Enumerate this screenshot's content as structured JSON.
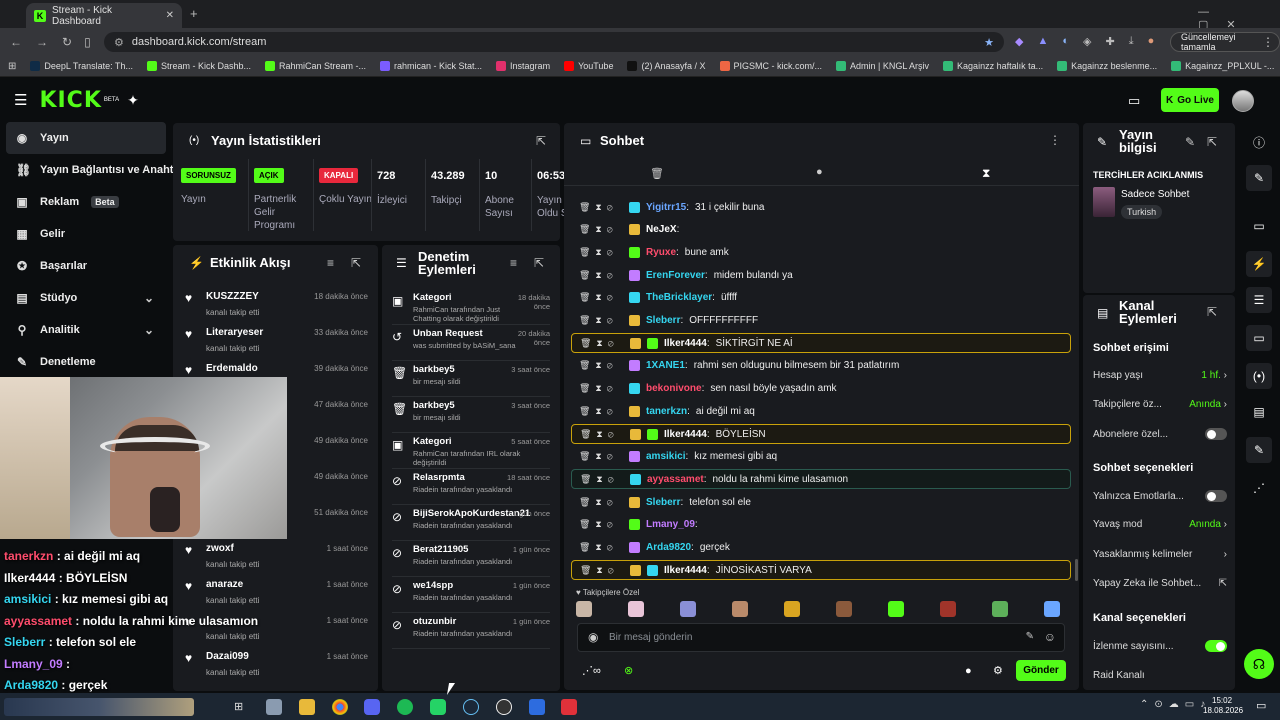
{
  "browser": {
    "tab_title": "Stream - Kick Dashboard",
    "url": "dashboard.kick.com/stream",
    "update_label": "Güncellemeyi tamamla",
    "bookmarks": [
      "DeepL Translate: Th...",
      "Stream - Kick Dashb...",
      "RahmiCan Stream -...",
      "rahmican - Kick Stat...",
      "Instagram",
      "YouTube",
      "(2) Anasayfa / X",
      "PIGSMC - kick.com/...",
      "Admin | KNGL Arşiv",
      "Kagainzz haftalık ta...",
      "Kagainzz beslenme...",
      "Kagainzz_PPLXUL -..."
    ]
  },
  "header": {
    "logo": "KICK",
    "logo_sup": "BETA",
    "go_live": "Go Live"
  },
  "sidebar": {
    "items": [
      {
        "label": "Yayın",
        "icon": "broadcast-icon"
      },
      {
        "label": "Yayın Bağlantısı ve Anahtar",
        "icon": "link-icon"
      },
      {
        "label": "Reklam",
        "icon": "ad-icon",
        "badge": "Beta"
      },
      {
        "label": "Gelir",
        "icon": "money-icon"
      },
      {
        "label": "Başarılar",
        "icon": "trophy-icon"
      },
      {
        "label": "Stüdyo",
        "icon": "studio-icon"
      },
      {
        "label": "Analitik",
        "icon": "chart-icon"
      },
      {
        "label": "Denetleme",
        "icon": "hammer-icon"
      }
    ]
  },
  "stats": {
    "title": "Yayın İstatistikleri",
    "cols": [
      {
        "tag": "SORUNSUZ",
        "label": "Yayın",
        "tag_color": "#53fc18"
      },
      {
        "tag": "AÇIK",
        "label": "Partnerlik Gelir Programı",
        "tag_color": "#53fc18"
      },
      {
        "tag": "KAPALI",
        "label": "Çoklu Yayın",
        "tag_color": "#e8283c"
      },
      {
        "value": "728",
        "label": "İzleyici"
      },
      {
        "value": "43.289",
        "label": "Takipçi"
      },
      {
        "value": "10",
        "label": "Abone Sayısı"
      },
      {
        "value": "06:53",
        "label": "Yayın Oldu Süre"
      }
    ]
  },
  "activity": {
    "title": "Etkinlik Akışı",
    "items": [
      {
        "name": "KUSZZZEY",
        "sub": "kanalı takip etti",
        "time": "18 dakika önce"
      },
      {
        "name": "Literaryeser",
        "sub": "kanalı takip etti",
        "time": "33 dakika önce"
      },
      {
        "name": "Erdemaldo",
        "sub": "",
        "time": "39 dakika önce"
      },
      {
        "name": "",
        "sub": "",
        "time": "47 dakika önce"
      },
      {
        "name": "elverinho",
        "sub": "",
        "time": "49 dakika önce"
      },
      {
        "name": "",
        "sub": "",
        "time": "49 dakika önce"
      },
      {
        "name": "",
        "sub": "",
        "time": "51 dakika önce"
      },
      {
        "name": "zwoxf",
        "sub": "kanalı takip etti",
        "time": "1 saat önce"
      },
      {
        "name": "anaraze",
        "sub": "kanalı takip etti",
        "time": "1 saat önce"
      },
      {
        "name": "",
        "sub": "kanalı takip etti",
        "time": "1 saat önce"
      },
      {
        "name": "Dazai099",
        "sub": "kanalı takip etti",
        "time": "1 saat önce"
      }
    ]
  },
  "audit": {
    "title": "Denetim Eylemleri",
    "items": [
      {
        "name": "Kategori",
        "sub": "RahmiCan tarafından Just Chatting olarak değiştirildi",
        "time": "18 dakika önce",
        "icon": "category-icon"
      },
      {
        "name": "Unban Request",
        "sub": "was submitted by bASiM_sana",
        "time": "20 dakika önce",
        "icon": "unban-icon"
      },
      {
        "name": "barkbey5",
        "sub": "bir mesajı sildi",
        "time": "3 saat önce",
        "icon": "trash-icon"
      },
      {
        "name": "barkbey5",
        "sub": "bir mesajı sildi",
        "time": "3 saat önce",
        "icon": "trash-icon"
      },
      {
        "name": "Kategori",
        "sub": "RahmiCan tarafından IRL olarak değiştirildi",
        "time": "5 saat önce",
        "icon": "category-icon"
      },
      {
        "name": "Relasrpmta",
        "sub": "Riadein tarafından yasaklandı",
        "time": "18 saat önce",
        "icon": "ban-icon"
      },
      {
        "name": "BijiSerokApoKurdestan21",
        "sub": "Riadein tarafından yasaklandı",
        "time": "1 gün önce",
        "icon": "ban-icon"
      },
      {
        "name": "Berat211905",
        "sub": "Riadein tarafından yasaklandı",
        "time": "1 gün önce",
        "icon": "ban-icon"
      },
      {
        "name": "we14spp",
        "sub": "Riadein tarafından yasaklandı",
        "time": "1 gün önce",
        "icon": "ban-icon"
      },
      {
        "name": "otuzunbir",
        "sub": "Riadein tarafından yasaklandı",
        "time": "1 gün önce",
        "icon": "ban-icon"
      }
    ]
  },
  "chat": {
    "title": "Sohbet",
    "messages": [
      {
        "user": "Yigitrr15",
        "text": "31 i çekilir buna",
        "color": "#6aa6ff",
        "style": ""
      },
      {
        "user": "NeJeX",
        "text": "",
        "color": "#ffffff",
        "style": ""
      },
      {
        "user": "Ryuxe",
        "text": "bune amk",
        "color": "#ff4d6d",
        "style": ""
      },
      {
        "user": "ErenForever",
        "text": "midem bulandı ya",
        "color": "#35d6f0",
        "style": ""
      },
      {
        "user": "TheBricklayer",
        "text": "üffff",
        "color": "#35d6f0",
        "style": ""
      },
      {
        "user": "Sleberr",
        "text": "OFFFFFFFFFF",
        "color": "#35d6f0",
        "style": ""
      },
      {
        "user": "Ilker4444",
        "text": "SİKTİRGİT NE Aİ",
        "color": "#ffffff",
        "style": "hl"
      },
      {
        "user": "1XANE1",
        "text": "rahmi sen oldugunu bilmesem bir 31 patlatırım",
        "color": "#35d6f0",
        "style": ""
      },
      {
        "user": "bekonivone",
        "text": "sen nasıl böyle yaşadın amk",
        "color": "#ff4d6d",
        "style": ""
      },
      {
        "user": "tanerkzn",
        "text": "ai değil mi aq",
        "color": "#35d6f0",
        "style": ""
      },
      {
        "user": "Ilker4444",
        "text": "BÖYLEİSN",
        "color": "#ffffff",
        "style": "hl"
      },
      {
        "user": "amsikici",
        "text": "kız memesi gibi aq",
        "color": "#35d6f0",
        "style": ""
      },
      {
        "user": "ayyassamet",
        "text": "noldu la rahmi kime ulasamıon",
        "color": "#ff4d6d",
        "style": "hl2"
      },
      {
        "user": "Sleberr",
        "text": "telefon sol ele",
        "color": "#35d6f0",
        "style": ""
      },
      {
        "user": "Lmany_09",
        "text": "",
        "color": "#c27cff",
        "style": ""
      },
      {
        "user": "Arda9820",
        "text": "gerçek",
        "color": "#35d6f0",
        "style": ""
      },
      {
        "user": "Ilker4444",
        "text": "JİNOSİKASTİ VARYA",
        "color": "#ffffff",
        "style": "hl"
      }
    ],
    "emote_row_label": "Takipçilere Özel",
    "input_placeholder": "Bir mesaj gönderin",
    "send_label": "Gönder"
  },
  "info": {
    "title": "Yayın bilgisi",
    "prefs_label": "TERCİHLER ACIKLANMIS",
    "stream_title": "Sadece Sohbet",
    "language": "Turkish"
  },
  "channel": {
    "title": "Kanal Eylemleri",
    "section1": "Sohbet erişimi",
    "account_age_label": "Hesap yaşı",
    "account_age_value": "1 hf.",
    "followers_label": "Takipçilere öz...",
    "followers_value": "Anında",
    "subs_label": "Abonelere özel...",
    "section2": "Sohbet seçenekleri",
    "emotes_label": "Yalnızca Emotlarla...",
    "slow_label": "Yavaş mod",
    "slow_value": "Anında",
    "banned_words": "Yasaklanmış kelimeler",
    "ai_label": "Yapay Zeka ile Sohbet...",
    "section3": "Kanal seçenekleri",
    "viewers_label": "İzlenme sayısını...",
    "raid_label": "Raid Kanalı"
  },
  "overlay": {
    "lines": [
      {
        "user": "tanerkzn",
        "text": " : ai değil mi aq",
        "color": "#ff4d6d"
      },
      {
        "user": "Ilker4444",
        "text": " : BÖYLEİSN",
        "color": "#ffffff"
      },
      {
        "user": "amsikici",
        "text": " : kız memesi gibi aq",
        "color": "#35d6f0"
      },
      {
        "user": "ayyassamet",
        "text": " : noldu la rahmi kime ulasamıon",
        "color": "#ff4d6d"
      },
      {
        "user": "Sleberr",
        "text": " : telefon sol ele",
        "color": "#35d6f0"
      },
      {
        "user": "Lmany_09",
        "text": " : ",
        "color": "#c27cff"
      },
      {
        "user": "Arda9820",
        "text": " : gerçek",
        "color": "#35d6f0"
      },
      {
        "user": "Ilker4444",
        "text": " : JİNOSİKASTİ VARYA",
        "color": "#ffffff"
      }
    ]
  },
  "taskbar": {
    "time": "15:02",
    "date": "18.08.2026"
  }
}
